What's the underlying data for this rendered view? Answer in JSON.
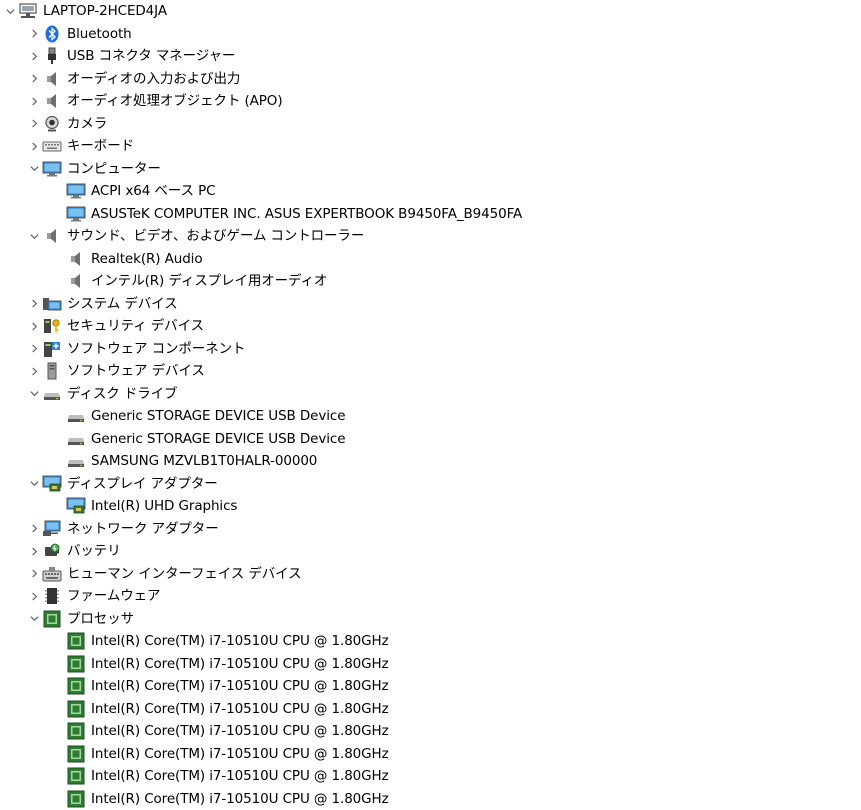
{
  "root": {
    "label": "LAPTOP-2HCED4JA",
    "icon": "computer-network-icon",
    "expanded": true
  },
  "categories": {
    "bluetooth": {
      "label": "Bluetooth",
      "icon": "bluetooth-icon",
      "expanded": false
    },
    "usb_connector": {
      "label": "USB コネクタ マネージャー",
      "icon": "usb-connector-icon",
      "expanded": false
    },
    "audio_io": {
      "label": "オーディオの入力および出力",
      "icon": "speaker-icon",
      "expanded": false
    },
    "audio_apo": {
      "label": "オーディオ処理オブジェクト (APO)",
      "icon": "speaker-icon",
      "expanded": false
    },
    "camera": {
      "label": "カメラ",
      "icon": "webcam-icon",
      "expanded": false
    },
    "keyboard": {
      "label": "キーボード",
      "icon": "keyboard-icon",
      "expanded": false
    },
    "computer": {
      "label": "コンピューター",
      "icon": "monitor-icon",
      "expanded": true,
      "children": [
        "ACPI x64 ベース PC",
        "ASUSTeK COMPUTER INC. ASUS EXPERTBOOK B9450FA_B9450FA"
      ]
    },
    "sound": {
      "label": "サウンド、ビデオ、およびゲーム コントローラー",
      "icon": "speaker-icon",
      "expanded": true,
      "children": [
        "Realtek(R) Audio",
        "インテル(R) ディスプレイ用オーディオ"
      ]
    },
    "system": {
      "label": "システム デバイス",
      "icon": "system-device-icon",
      "expanded": false
    },
    "security": {
      "label": "セキュリティ デバイス",
      "icon": "security-key-icon",
      "expanded": false
    },
    "software_component": {
      "label": "ソフトウェア コンポーネント",
      "icon": "software-component-icon",
      "expanded": false
    },
    "software_device": {
      "label": "ソフトウェア デバイス",
      "icon": "software-device-icon",
      "expanded": false
    },
    "disk": {
      "label": "ディスク ドライブ",
      "icon": "disk-drive-icon",
      "expanded": true,
      "children": [
        "Generic STORAGE DEVICE USB Device",
        "Generic STORAGE DEVICE USB Device",
        "SAMSUNG MZVLB1T0HALR-00000"
      ]
    },
    "display": {
      "label": "ディスプレイ アダプター",
      "icon": "display-adapter-icon",
      "expanded": true,
      "children": [
        "Intel(R) UHD Graphics"
      ]
    },
    "network": {
      "label": "ネットワーク アダプター",
      "icon": "network-adapter-icon",
      "expanded": false
    },
    "battery": {
      "label": "バッテリ",
      "icon": "battery-icon",
      "expanded": false
    },
    "hid": {
      "label": "ヒューマン インターフェイス デバイス",
      "icon": "hid-icon",
      "expanded": false
    },
    "firmware": {
      "label": "ファームウェア",
      "icon": "firmware-icon",
      "expanded": false
    },
    "processor": {
      "label": "プロセッサ",
      "icon": "processor-icon",
      "expanded": true,
      "children": [
        "Intel(R) Core(TM) i7-10510U CPU @ 1.80GHz",
        "Intel(R) Core(TM) i7-10510U CPU @ 1.80GHz",
        "Intel(R) Core(TM) i7-10510U CPU @ 1.80GHz",
        "Intel(R) Core(TM) i7-10510U CPU @ 1.80GHz",
        "Intel(R) Core(TM) i7-10510U CPU @ 1.80GHz",
        "Intel(R) Core(TM) i7-10510U CPU @ 1.80GHz",
        "Intel(R) Core(TM) i7-10510U CPU @ 1.80GHz",
        "Intel(R) Core(TM) i7-10510U CPU @ 1.80GHz"
      ]
    }
  },
  "colors": {
    "arrow": "#606060",
    "bluetooth": "#1e6fd9",
    "monitor_blue": "#2a83d6",
    "chip_green": "#2e7d32",
    "gray": "#8a8a8a"
  }
}
